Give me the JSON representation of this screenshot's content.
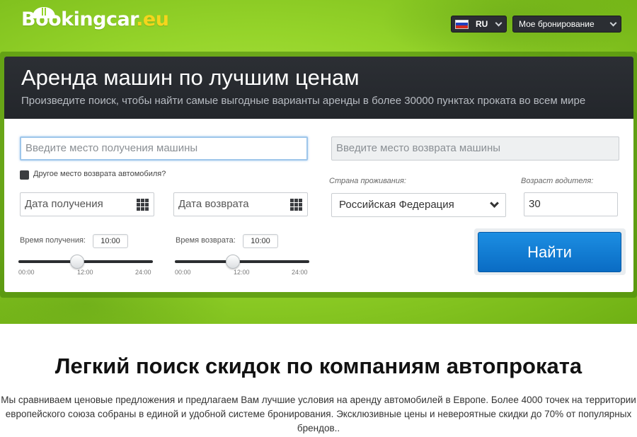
{
  "header": {
    "logo": {
      "name": "Bookingcar",
      "tld": ".eu"
    },
    "language": {
      "code": "RU",
      "flag": "russia-flag-icon"
    },
    "booking_menu": "Мое бронирование"
  },
  "search_panel": {
    "title": "Аренда машин по лучшим ценам",
    "subtitle": "Произведите поиск, чтобы найти самые выгодные варианты аренды в более 30000 пунктах проката во всем мире",
    "pickup_placeholder": "Введите место получения машины",
    "return_placeholder": "Введите место возврата машины",
    "different_return_label": "Другое место возврата автомобиля?",
    "pickup_date_placeholder": "Дата получения",
    "return_date_placeholder": "Дата возврата",
    "country_label": "Страна проживания:",
    "country_value": "Российская Федерация",
    "age_label": "Возраст водителя:",
    "age_value": "30",
    "pickup_time_label": "Время получения:",
    "pickup_time": "10:00",
    "return_time_label": "Время возврата:",
    "return_time": "10:00",
    "time_ticks": [
      "00:00",
      "12:00",
      "24:00"
    ],
    "search_button": "Найти",
    "accent_color": "#0f7bd3"
  },
  "promo": {
    "title": "Легкий поиск скидок по компаниям автопроката",
    "text": "Мы сравниваем ценовые предложения и предлагаем Вам лучшие условия на аренду автомобилей в Европе. Более 4000 точек на территории европейского союза собраны в единой и удобной системе бронирования. Эксклюзивные цены и невероятные скидки до 70% от популярных брендов.."
  }
}
